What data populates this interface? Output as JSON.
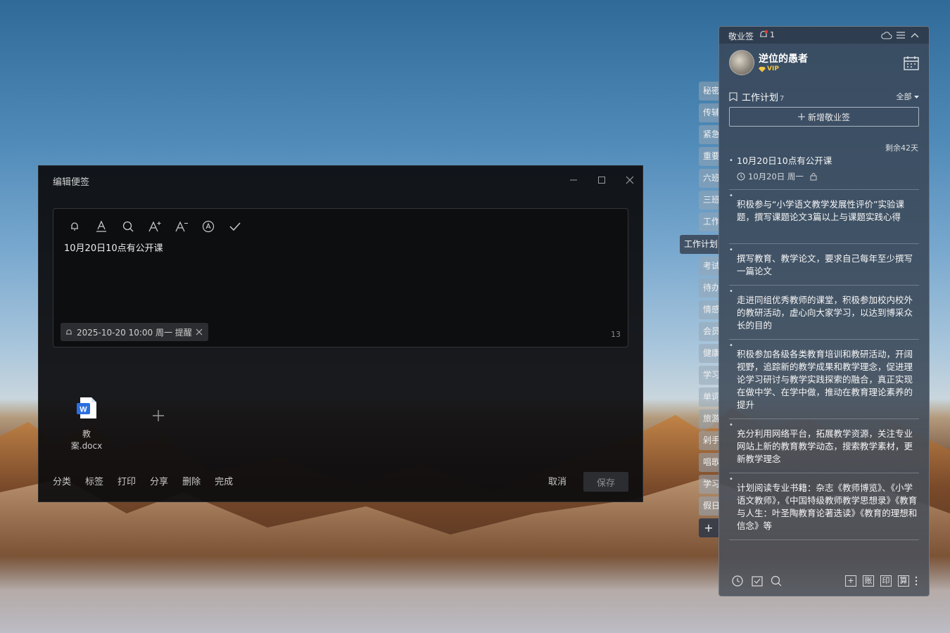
{
  "editor": {
    "title": "编辑便签",
    "note_text": "10月20日10点有公开课",
    "reminder_chip": "2025-10-20 10:00 周一 提醒",
    "char_count": "13",
    "attachment": {
      "name": "教案.docx",
      "icon": "word-doc-icon"
    },
    "footer_actions": [
      "分类",
      "标签",
      "打印",
      "分享",
      "删除",
      "完成"
    ],
    "cancel_label": "取消",
    "save_label": "保存"
  },
  "side_tabs": [
    "秘密",
    "传辅",
    "紧急",
    "重要",
    "六班",
    "三班",
    "工作",
    "工作计划",
    "考试",
    "待办",
    "情感",
    "会员",
    "健康",
    "学习",
    "单词",
    "旅游",
    "剁手",
    "唱歌",
    "学习",
    "假日"
  ],
  "widget": {
    "app_name": "敬业签",
    "notification_count": "1",
    "user": {
      "name": "逆位的愚者",
      "badge": "VIP"
    },
    "category": {
      "title": "工作计划",
      "count": "7",
      "filter": "全部"
    },
    "add_button": "新增敬业签",
    "remaining": "剩余42天",
    "notes": [
      {
        "text": "10月20日10点有公开课",
        "date": "10月20日 周一"
      },
      {
        "text": "积极参与“小学语文教学发展性评价”实验课题，撰写课题论文3篇以上与课题实践心得"
      },
      {
        "text": "撰写教育、教学论文，要求自己每年至少撰写一篇论文"
      },
      {
        "text": "走进同组优秀教师的课堂，积极参加校内校外的教研活动，虚心向大家学习，以达到博采众长的目的"
      },
      {
        "text": "积极参加各级各类教育培训和教研活动，开阔视野，追踪新的教学成果和教学理念，促进理论学习研讨与教学实践探索的融合，真正实现在做中学、在学中做，推动在教育理论素养的提升"
      },
      {
        "text": "充分利用网络平台，拓展教学资源，关注专业网站上新的教育教学动态，搜索教学素材，更新教学理念"
      },
      {
        "text": "计划阅读专业书籍：杂志《教师博览》、《小学语文教师》，《中国特级教师教学思想录》《教育与人生：叶圣陶教育论著选读》《教育的理想和信念》等"
      }
    ],
    "bottom_tools": [
      "加",
      "账",
      "印",
      "算"
    ]
  }
}
